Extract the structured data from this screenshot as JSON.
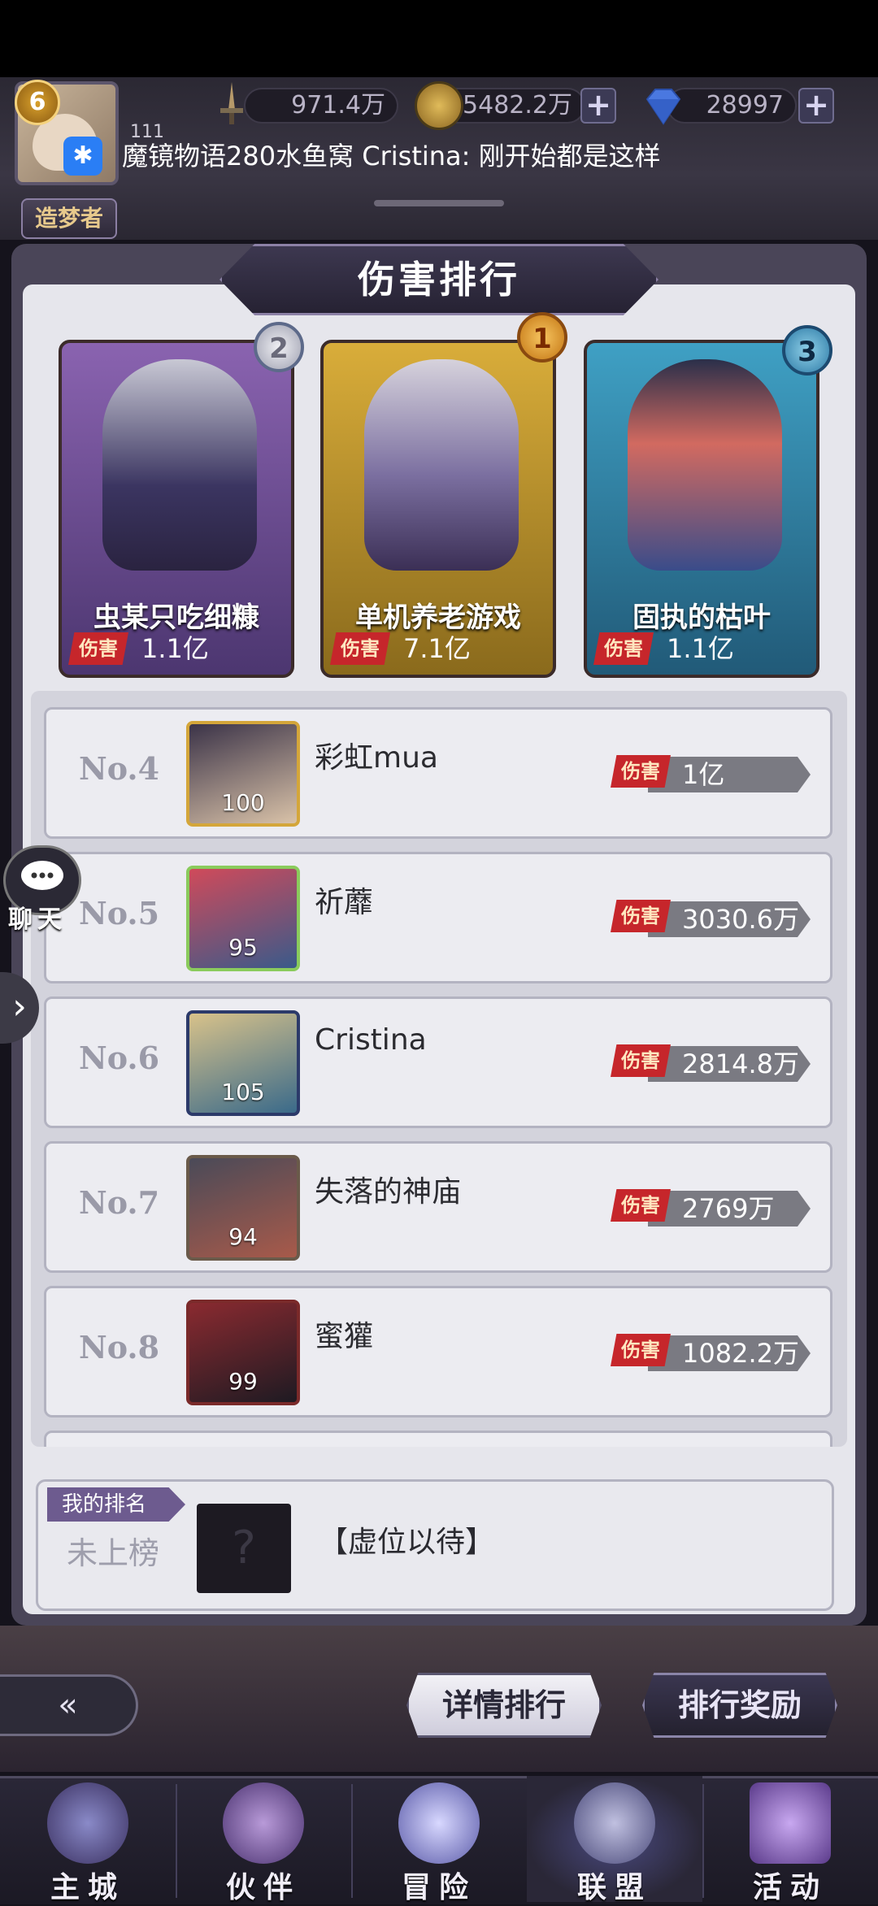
{
  "hud": {
    "level": "6",
    "title_badge": "造梦者",
    "small_id": "111",
    "power": "971.4万",
    "gold": "5482.2万",
    "diamonds": "28997",
    "plus": "+",
    "chat_message": "魔镜物语280水鱼窝   Cristina: 刚开始都是这样"
  },
  "panel": {
    "title": "伤害排行",
    "damage_tag": "伤害"
  },
  "top3": [
    {
      "rank_badge": "2",
      "name": "虫某只吃细糠",
      "damage": "1.1亿"
    },
    {
      "rank_badge": "1",
      "name": "单机养老游戏",
      "damage": "7.1亿"
    },
    {
      "rank_badge": "3",
      "name": "固执的枯叶",
      "damage": "1.1亿"
    }
  ],
  "rows": [
    {
      "rank": "No.4",
      "level": "100",
      "name": "彩虹mua",
      "damage": "1亿"
    },
    {
      "rank": "No.5",
      "level": "95",
      "name": "祈蘼",
      "damage": "3030.6万"
    },
    {
      "rank": "No.6",
      "level": "105",
      "name": "Cristina",
      "damage": "2814.8万"
    },
    {
      "rank": "No.7",
      "level": "94",
      "name": "失落的神庙",
      "damage": "2769万"
    },
    {
      "rank": "No.8",
      "level": "99",
      "name": "蜜獾",
      "damage": "1082.2万"
    }
  ],
  "my_rank": {
    "tab_label": "我的排名",
    "status": "未上榜",
    "placeholder_glyph": "?",
    "name": "【虚位以待】"
  },
  "side": {
    "chat_label": "聊天",
    "arrow": "›"
  },
  "buttons": {
    "back": "«",
    "details": "详情排行",
    "rewards": "排行奖励"
  },
  "nav": [
    {
      "label": "主城"
    },
    {
      "label": "伙伴"
    },
    {
      "label": "冒险"
    },
    {
      "label": "联盟"
    },
    {
      "label": "活动"
    }
  ],
  "colors": {
    "damage_red": "#c6262b",
    "gold_frame": "#c9a445",
    "card_purple": "#6b4b8c",
    "card_gold": "#b98a2b",
    "card_blue": "#2e7d9c"
  }
}
